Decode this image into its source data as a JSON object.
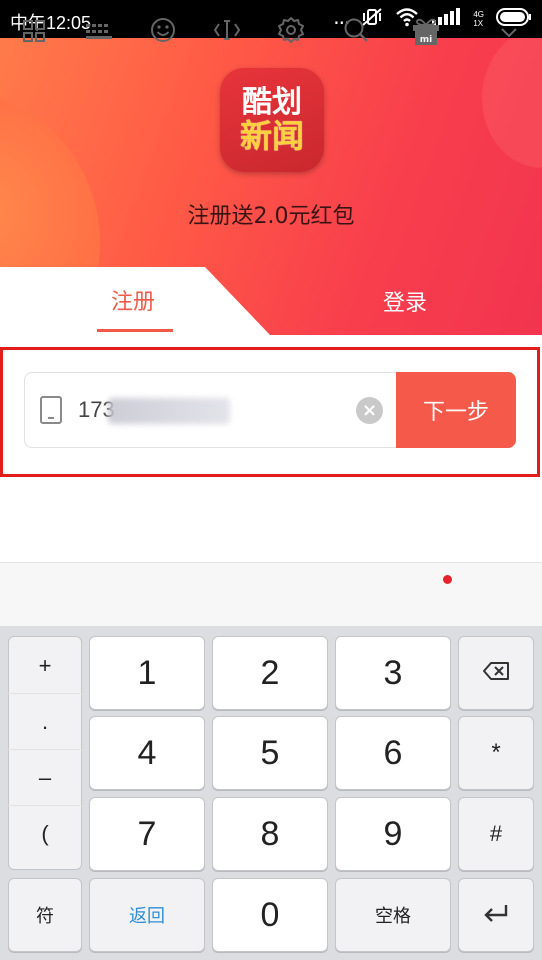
{
  "status_bar": {
    "time": "中午12:05",
    "dots": "...",
    "network": [
      "4G",
      "1X"
    ],
    "icons": [
      "vibrate-off-icon",
      "wifi-icon",
      "signal-icon",
      "battery-icon"
    ]
  },
  "header": {
    "logo_line1": "酷划",
    "logo_line2": "新闻",
    "promo": "注册送2.0元红包"
  },
  "tabs": {
    "register": "注册",
    "login": "登录"
  },
  "form": {
    "phone_value": "173",
    "next_button": "下一步"
  },
  "keyboard_toolbar": {
    "icons": [
      "grid-icon",
      "keyboard-icon",
      "emoji-icon",
      "cursor-icon",
      "settings-icon",
      "search-icon",
      "gift-icon",
      "chevron-down-icon"
    ]
  },
  "keyboard": {
    "symbols": [
      "+",
      ".",
      "–",
      "("
    ],
    "digits": [
      "1",
      "2",
      "3",
      "4",
      "5",
      "6",
      "7",
      "8",
      "9",
      "0"
    ],
    "star": "*",
    "hash": "#",
    "symbol_key": "符",
    "back_key": "返回",
    "space_key": "空格"
  },
  "colors": {
    "accent": "#f5594a",
    "header_gradient": [
      "#ff7b4a",
      "#f2344e"
    ],
    "highlight_border": "#e21b1b",
    "back_key_text": "#2f8fd8"
  }
}
